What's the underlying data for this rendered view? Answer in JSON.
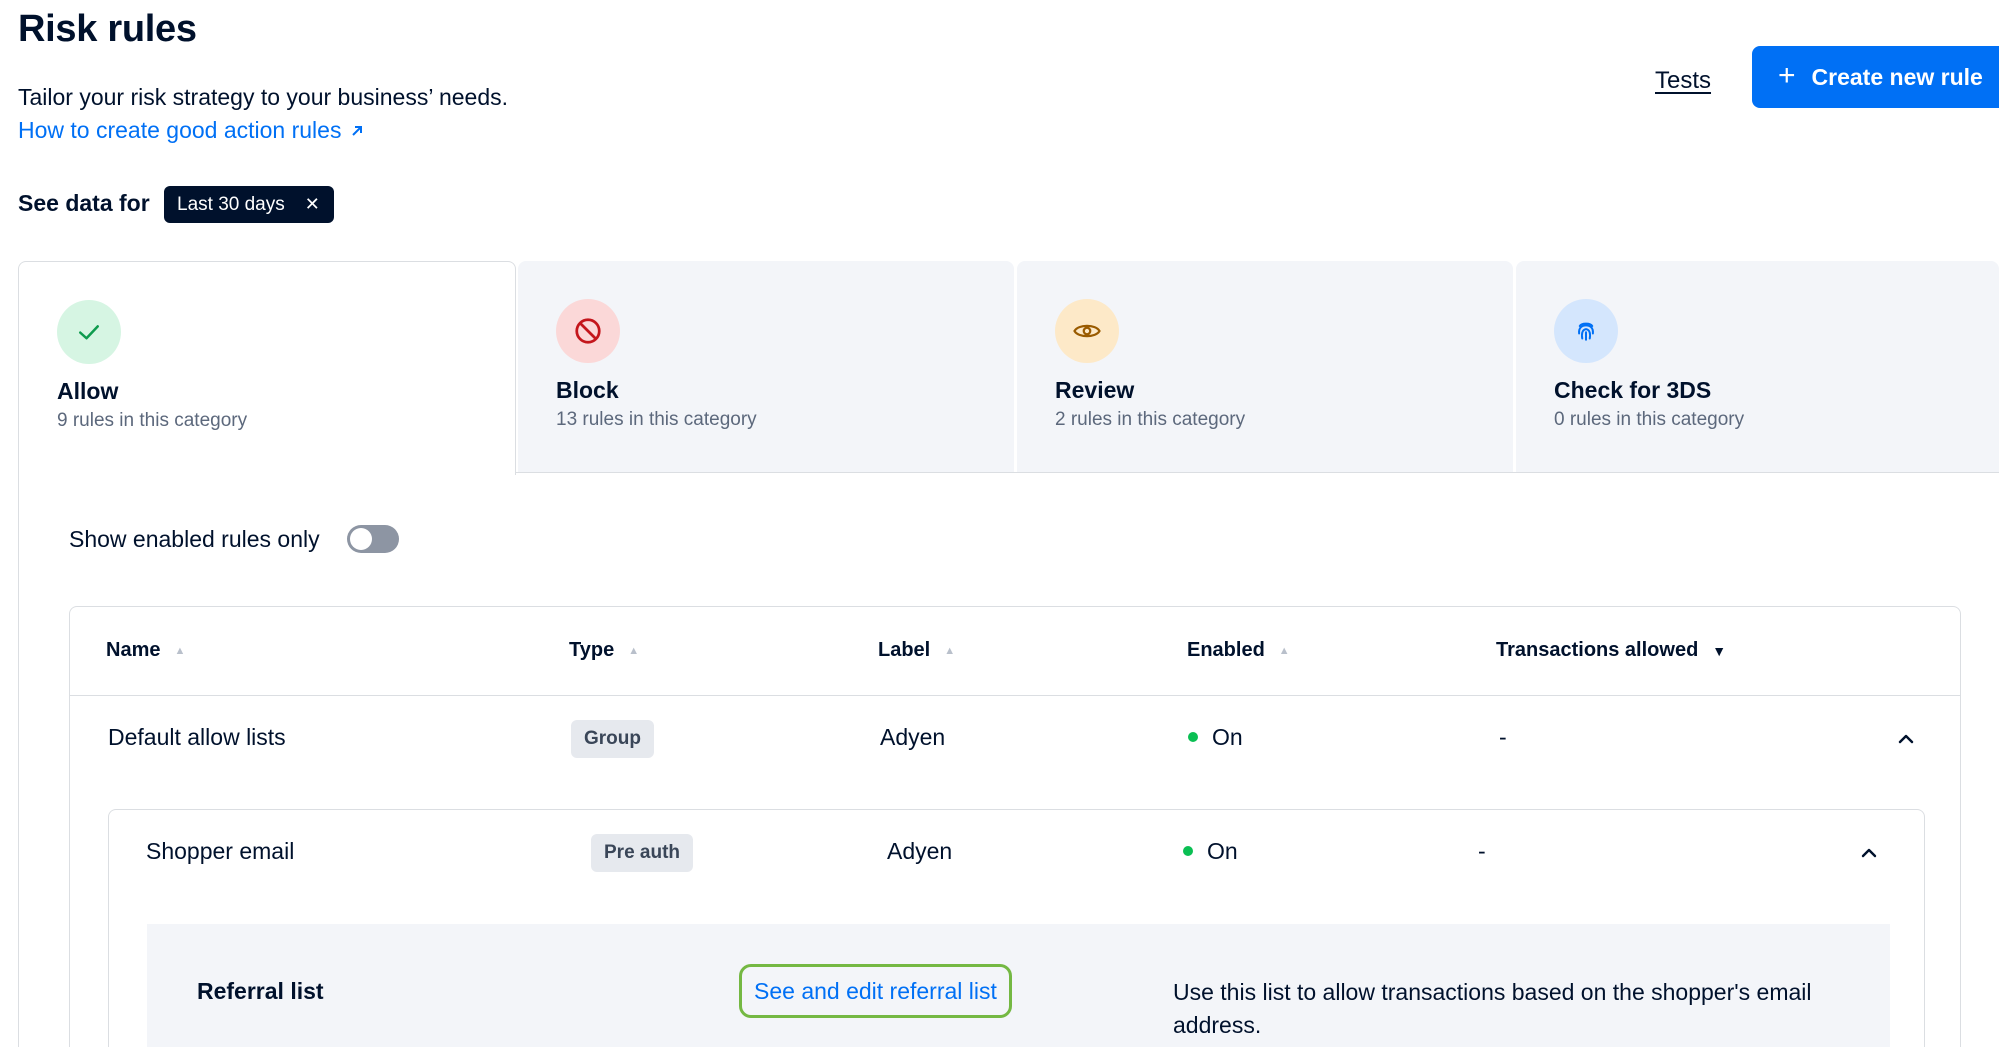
{
  "header": {
    "title": "Risk rules",
    "subtitle": "Tailor your risk strategy to your business’ needs.",
    "help_link": "How to create good action rules",
    "tests_link": "Tests",
    "create_button": "Create new rule"
  },
  "filter": {
    "label": "See data for",
    "chip": "Last 30 days"
  },
  "categories": [
    {
      "title": "Allow",
      "subtitle": "9 rules in this category",
      "icon": "check-icon",
      "color": "#d6f5e3"
    },
    {
      "title": "Block",
      "subtitle": "13 rules in this category",
      "icon": "block-icon",
      "color": "#fbd8d8"
    },
    {
      "title": "Review",
      "subtitle": "2 rules in this category",
      "icon": "eye-icon",
      "color": "#fde9c8"
    },
    {
      "title": "Check for 3DS",
      "subtitle": "0 rules in this category",
      "icon": "fingerprint-icon",
      "color": "#d4e6fd"
    }
  ],
  "toggle": {
    "label": "Show enabled rules only",
    "enabled": false
  },
  "table": {
    "columns": [
      "Name",
      "Type",
      "Label",
      "Enabled",
      "Transactions allowed"
    ],
    "rows": [
      {
        "name": "Default allow lists",
        "type": "Group",
        "label": "Adyen",
        "enabled": "On",
        "transactions": "-"
      }
    ],
    "nested": {
      "name": "Shopper email",
      "type": "Pre auth",
      "label": "Adyen",
      "enabled": "On",
      "transactions": "-",
      "detail": {
        "label": "Referral list",
        "link": "See and edit referral list",
        "description": "Use this list to allow transactions based on the shopper's email address."
      }
    }
  }
}
